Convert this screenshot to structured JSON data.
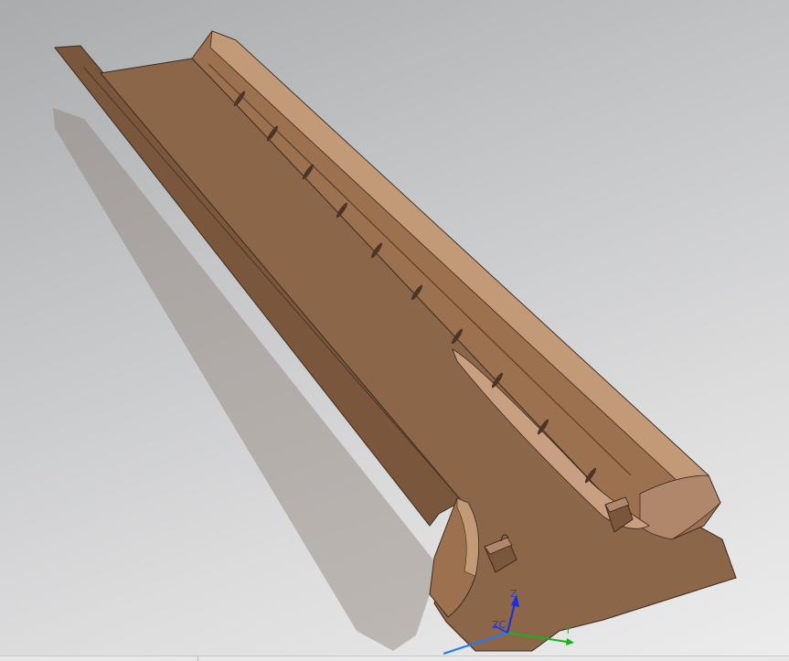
{
  "viewport": {
    "background_top": "#a9abad",
    "background_bottom": "#ececec"
  },
  "model": {
    "material_color": "#8c6648",
    "highlight_color": "#c39a78",
    "edge_color": "#3a2a1e",
    "shadow_color": "#8a7a70"
  },
  "triad": {
    "z_label": "Z",
    "zc_label": "ZC",
    "y_label": "Y",
    "x_color": "#1e78ff",
    "y_color": "#17b51d",
    "z_color": "#1a2ee0"
  }
}
